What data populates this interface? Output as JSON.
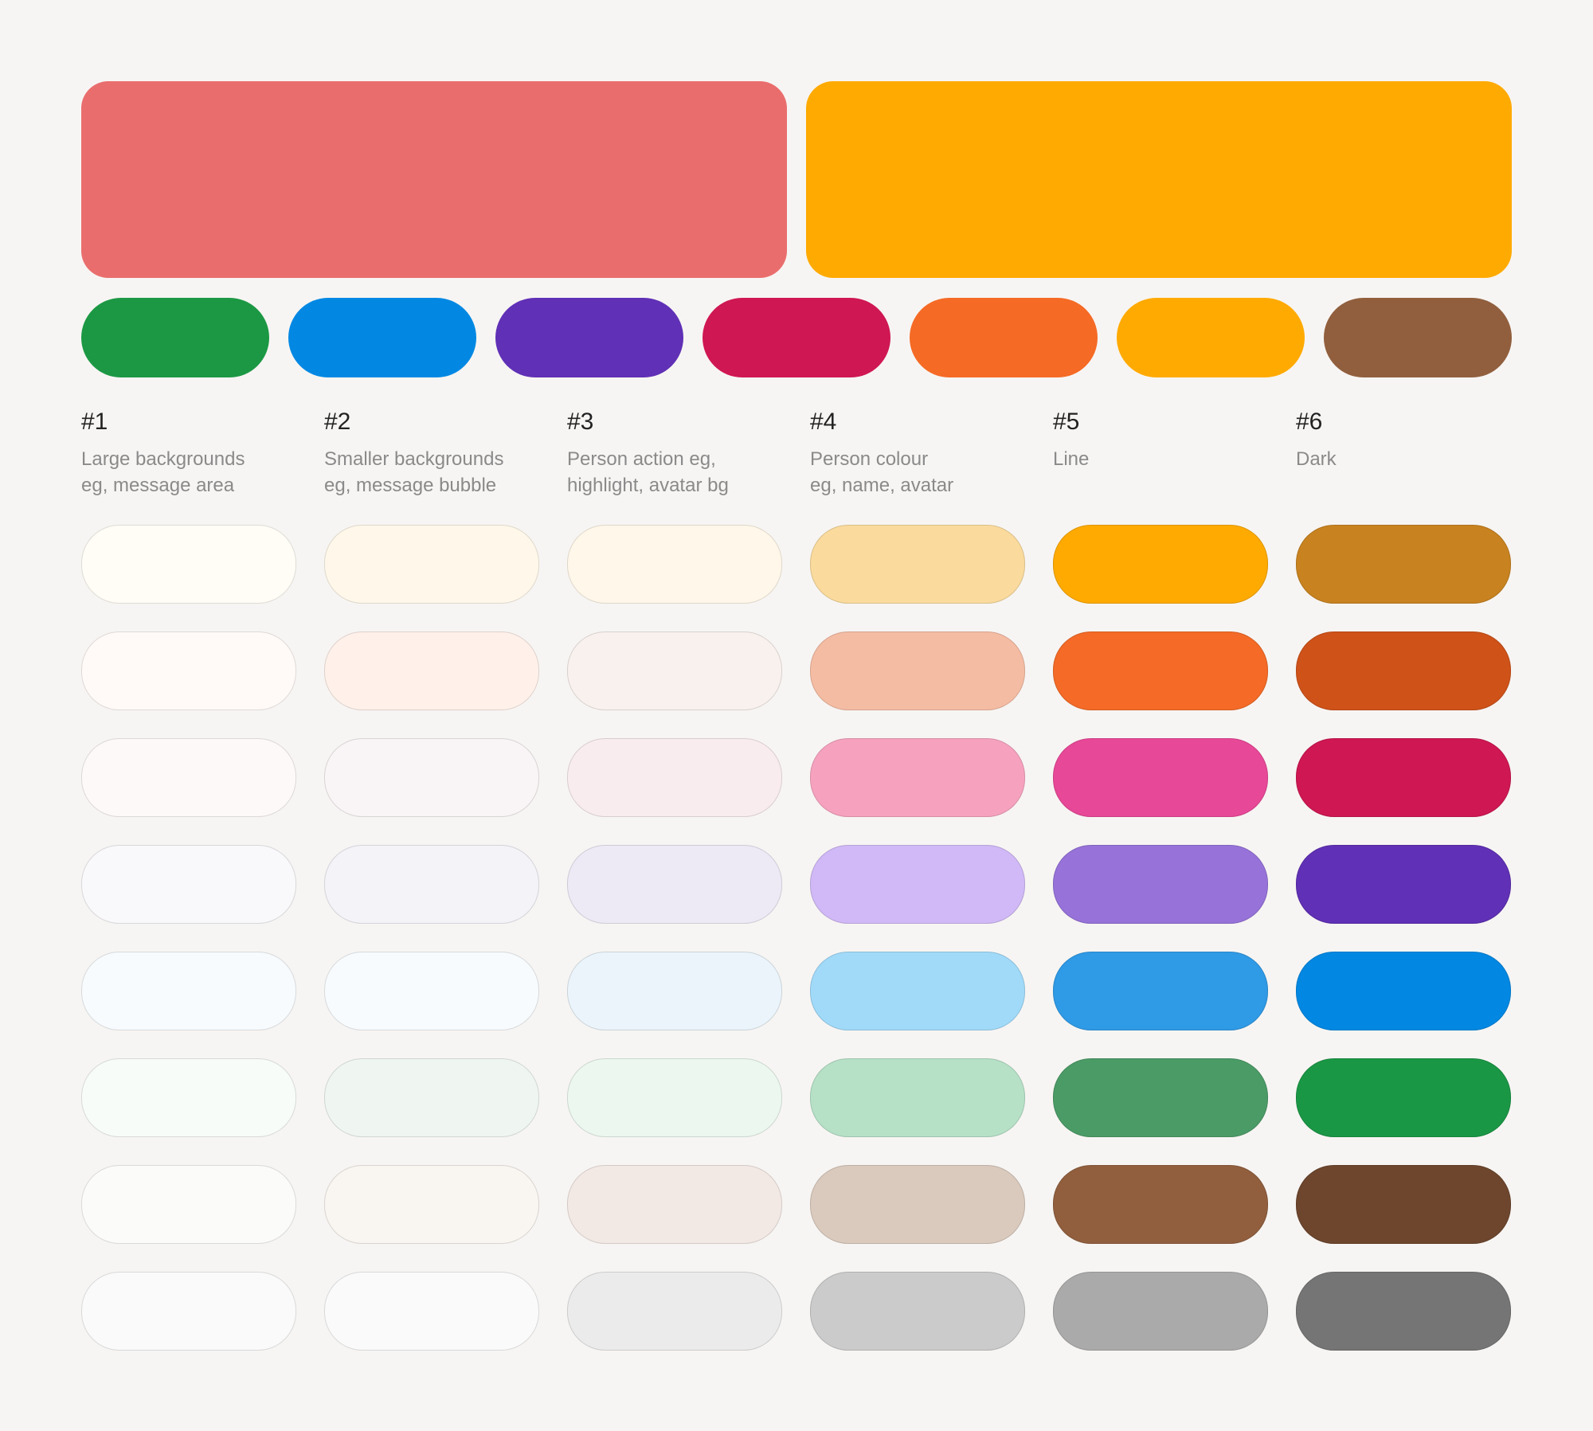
{
  "hero_colors": [
    "#ea6d6d",
    "#ffaa00"
  ],
  "chip_colors": [
    "#1c9844",
    "#0288e3",
    "#6030b6",
    "#cf1753",
    "#f56a25",
    "#ffaa00",
    "#915f3e"
  ],
  "columns": [
    {
      "number": "#1",
      "desc_line1": "Large backgrounds",
      "desc_line2": "eg, message area",
      "swatches": [
        "#fffdf5",
        "#fffaf7",
        "#fdf9f9",
        "#f9f9fb",
        "#f7fbfd",
        "#f7fcf9",
        "#fbfbf9",
        "#fafafa"
      ]
    },
    {
      "number": "#2",
      "desc_line1": "Smaller backgrounds",
      "desc_line2": "eg, message bubble",
      "swatches": [
        "#fff8ea",
        "#fff1ea",
        "#f9f4f5",
        "#f4f3f8",
        "#f7fbfd",
        "#eff6f1",
        "#f9f5f0",
        "#fafafa"
      ]
    },
    {
      "number": "#3",
      "desc_line1": "Person action eg,",
      "desc_line2": "highlight, avatar bg",
      "swatches": [
        "#fff7e9",
        "#f9f1ed",
        "#f8ecef",
        "#edeaf6",
        "#eaf4fa",
        "#ebf7ef",
        "#f3e9e4",
        "#ebebeb"
      ]
    },
    {
      "number": "#4",
      "desc_line1": "Person colour",
      "desc_line2": "eg, name, avatar",
      "swatches": [
        "#fadb9d",
        "#f5bca4",
        "#f6a2bf",
        "#d0b9f6",
        "#a1daf9",
        "#b6e1c7",
        "#dacabd",
        "#cbcbcb"
      ]
    },
    {
      "number": "#5",
      "desc_line1": "Line",
      "desc_line2": "",
      "swatches": [
        "#ffaa00",
        "#f46a26",
        "#e84898",
        "#9672d9",
        "#2f9ae6",
        "#4b9b67",
        "#915f3e",
        "#aaaaaa"
      ]
    },
    {
      "number": "#6",
      "desc_line1": "Dark",
      "desc_line2": "",
      "swatches": [
        "#c8821f",
        "#cf5219",
        "#cf1753",
        "#6030b6",
        "#0288e3",
        "#1a9745",
        "#6d462d",
        "#757575"
      ]
    }
  ]
}
